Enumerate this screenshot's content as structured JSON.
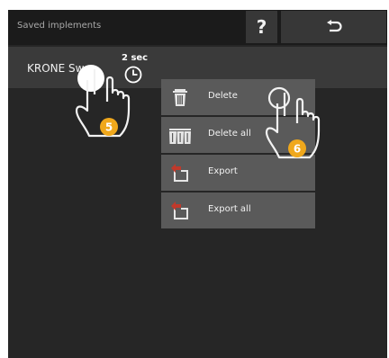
{
  "header": {
    "title": "Saved implements",
    "help_label": "?"
  },
  "row": {
    "label": "KRONE Sw"
  },
  "timer": {
    "label": "2 sec"
  },
  "menu": {
    "items": [
      {
        "label": "Delete",
        "icon": "trash-icon"
      },
      {
        "label": "Delete all",
        "icon": "trash-multiple-icon"
      },
      {
        "label": "Export",
        "icon": "export-icon"
      },
      {
        "label": "Export all",
        "icon": "export-all-icon"
      }
    ]
  },
  "steps": {
    "first": "5",
    "second": "6"
  },
  "colors": {
    "accent": "#f0a81c",
    "export_arrow": "#c0392b"
  }
}
